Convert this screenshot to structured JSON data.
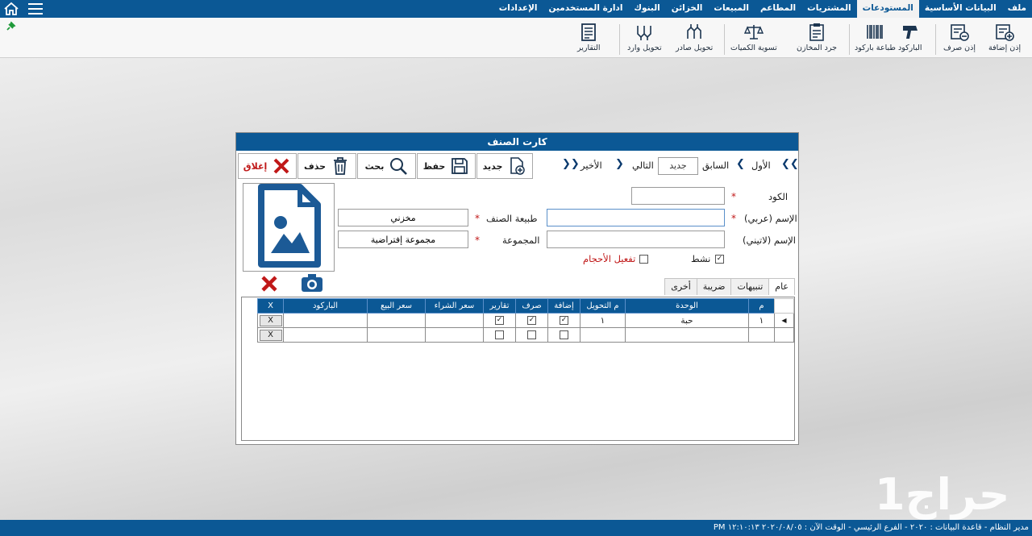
{
  "menu": {
    "tabs": [
      "ملف",
      "البيانات الأساسية",
      "المستودعات",
      "المشتريات",
      "المطاعم",
      "المبيعات",
      "الخزائن",
      "البنوك",
      "ادارة المستخدمين",
      "الإعدادات"
    ],
    "active_index": 2
  },
  "ribbon": {
    "buttons": [
      "إذن إضافة",
      "إذن صرف",
      "الباركود",
      "طباعة باركود",
      "جرد المخازن",
      "تسوية الكميات",
      "تحويل صادر",
      "تحويل وارد",
      "التقارير"
    ]
  },
  "dialog": {
    "title": "كارت الصنف",
    "toolbar": {
      "new_label": "جديد",
      "save_label": "حفظ",
      "search_label": "بحث",
      "delete_label": "حذف",
      "close_label": "إغلاق"
    },
    "nav": {
      "first": "الأول",
      "prev": "السابق",
      "status": "جديد",
      "next": "التالي",
      "last": "الأخير"
    },
    "form": {
      "code_label": "الكود",
      "name_ar_label": "الإسم (عربي)",
      "name_en_label": "الإسم (لاتيني)",
      "item_nature_label": "طبيعة الصنف",
      "item_nature_value": "مخزني",
      "group_label": "المجموعة",
      "group_value": "مجموعة إفتراضية",
      "active_label": "نشط",
      "enable_sizes_label": "تفعيل الأحجام",
      "required_mark": "*"
    },
    "tabs": [
      "عام",
      "تنبيهات",
      "ضريبة",
      "أخرى"
    ],
    "grid": {
      "headers": [
        "م",
        "الوحدة",
        "م التحويل",
        "إضافة",
        "صرف",
        "تقارير",
        "سعر الشراء",
        "سعر البيع",
        "الباركود",
        "X"
      ],
      "rows": [
        {
          "index": "١",
          "unit": "حبة",
          "conversion": "١",
          "add": true,
          "issue": true,
          "reports": true,
          "buy": "",
          "sell": "",
          "barcode": "",
          "x": "X"
        },
        {
          "index": "",
          "unit": "",
          "conversion": "",
          "add": false,
          "issue": false,
          "reports": false,
          "buy": "",
          "sell": "",
          "barcode": "",
          "x": "X"
        }
      ]
    }
  },
  "watermark": "حراج1",
  "status_bar": "مدير النظام  -  قاعدة البيانات : ٢٠٢٠  -  الفرع الرئيسي  -  الوقت الآن :  ٢٠٢٠/٠٨/٠٥ ١٢:١٠:١٣ PM",
  "colors": {
    "primary": "#0b5895",
    "danger": "#c01818"
  }
}
